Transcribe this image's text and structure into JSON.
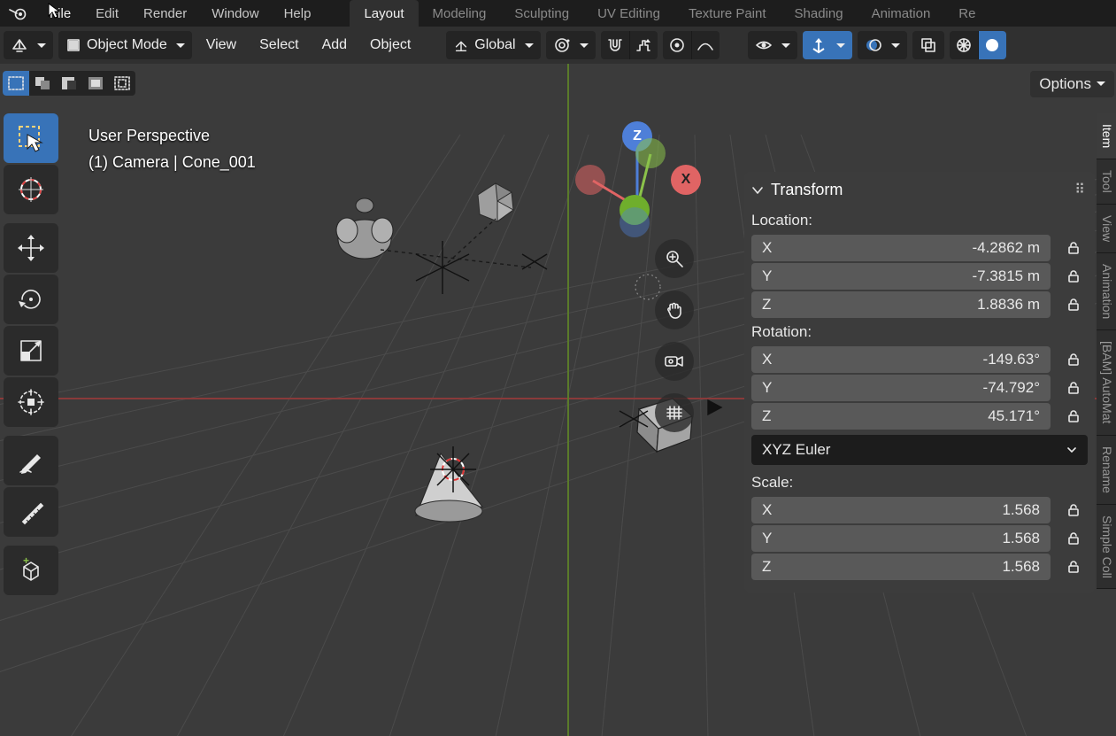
{
  "menu": {
    "items": [
      "File",
      "Edit",
      "Render",
      "Window",
      "Help"
    ]
  },
  "workspaces": [
    "Layout",
    "Modeling",
    "Sculpting",
    "UV Editing",
    "Texture Paint",
    "Shading",
    "Animation",
    "Re"
  ],
  "active_workspace": "Layout",
  "toolhdr": {
    "mode": "Object Mode",
    "words": [
      "View",
      "Select",
      "Add",
      "Object"
    ],
    "orient": "Global",
    "options_btn": "Options"
  },
  "viewport_label": {
    "line1": "User Perspective",
    "line2": "(1) Camera | Cone_001"
  },
  "gizmo": {
    "x": "X",
    "z": "Z"
  },
  "npanel": {
    "title": "Transform",
    "loc_label": "Location:",
    "rot_label": "Rotation:",
    "scale_label": "Scale:",
    "rot_mode": "XYZ Euler",
    "loc": [
      {
        "a": "X",
        "v": "-4.2862 m"
      },
      {
        "a": "Y",
        "v": "-7.3815 m"
      },
      {
        "a": "Z",
        "v": "1.8836 m"
      }
    ],
    "rot": [
      {
        "a": "X",
        "v": "-149.63°"
      },
      {
        "a": "Y",
        "v": "-74.792°"
      },
      {
        "a": "Z",
        "v": "45.171°"
      }
    ],
    "scale": [
      {
        "a": "X",
        "v": "1.568"
      },
      {
        "a": "Y",
        "v": "1.568"
      },
      {
        "a": "Z",
        "v": "1.568"
      }
    ]
  },
  "rtabs": [
    "Item",
    "Tool",
    "View",
    "Animation",
    "[BAM] AutoMat",
    "Rename",
    "Simple Coll"
  ],
  "colors": {
    "x": "#e06464",
    "y": "#6fae2c",
    "z": "#4e7fd8",
    "accent": "#3873b8"
  }
}
